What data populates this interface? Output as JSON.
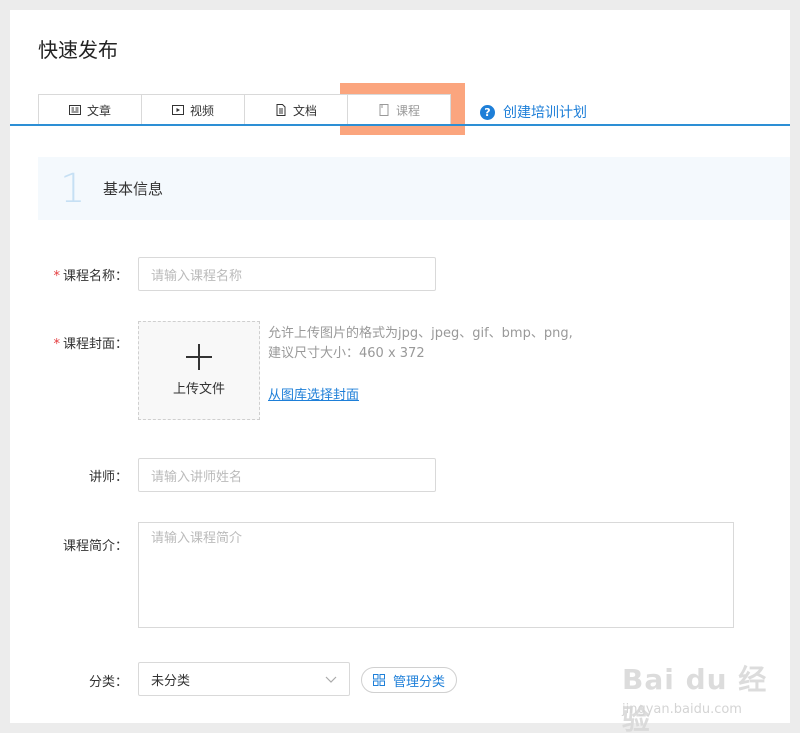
{
  "page": {
    "title": "快速发布"
  },
  "tabs": [
    {
      "label": "文章",
      "icon": "article-icon"
    },
    {
      "label": "视频",
      "icon": "video-icon"
    },
    {
      "label": "文档",
      "icon": "document-icon"
    },
    {
      "label": "课程",
      "icon": "course-icon",
      "active": true
    }
  ],
  "plan_link": {
    "label": "创建培训计划",
    "icon": "help-icon"
  },
  "section": {
    "number": "1",
    "title": "基本信息"
  },
  "form": {
    "course_name": {
      "label": "课程名称：",
      "placeholder": "请输入课程名称",
      "required": true
    },
    "cover": {
      "label": "课程封面：",
      "required": true,
      "upload_label": "上传文件",
      "hint_line1": "允许上传图片的格式为jpg、jpeg、gif、bmp、png,",
      "hint_line2": "建议尺寸大小：460 x 372",
      "gallery_link": "从图库选择封面"
    },
    "teacher": {
      "label": "讲师：",
      "placeholder": "请输入讲师姓名"
    },
    "intro": {
      "label": "课程简介：",
      "placeholder": "请输入课程简介"
    },
    "category": {
      "label": "分类：",
      "value": "未分类",
      "manage_label": "管理分类"
    }
  },
  "watermark": {
    "text": "Bai du 经验",
    "sub": "jingyan.baidu.com"
  },
  "colors": {
    "accent": "#1e7fd8",
    "tab_line": "#2d8fd5",
    "required": "#e4393c",
    "highlight": "#fa8c5a"
  }
}
